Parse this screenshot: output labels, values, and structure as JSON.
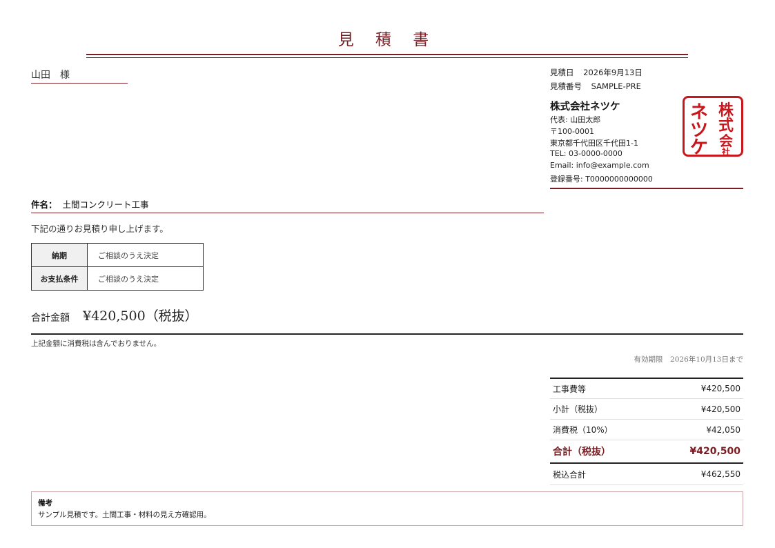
{
  "title": "見 積 書",
  "recipient": "山田　様",
  "meta": {
    "date_label": "見積日",
    "date_value": "2026年9月13日",
    "number_label": "見積番号",
    "number_value": "SAMPLE-PRE"
  },
  "company": {
    "name": "株式会社ネツケ",
    "representative": "代表: 山田太郎",
    "postal": "〒100-0001",
    "address": "東京都千代田区千代田1-1",
    "tel": "TEL: 03-0000-0000",
    "email": "Email: info@example.com",
    "registration": "登録番号: T0000000000000",
    "stamp_text": "株式会社ネツケ",
    "stamp_color": "#c8161d"
  },
  "subject": {
    "label": "件名：",
    "value": "土間コンクリート工事"
  },
  "lead_text": "下記の通りお見積り申し上げます。",
  "terms": [
    {
      "label": "納期",
      "value": "ご相談のうえ決定"
    },
    {
      "label": "お支払条件",
      "value": "ご相談のうえ決定"
    }
  ],
  "total": {
    "label": "合計金額",
    "value": "¥420,500（税抜）"
  },
  "tax_note": "上記金額に消費税は含んでおりません。",
  "validity": "有効期限　2026年10月13日まで",
  "summary": [
    {
      "label": "工事費等",
      "value": "¥420,500"
    },
    {
      "label": "小計（税抜）",
      "value": "¥420,500"
    },
    {
      "label": "消費税（10%）",
      "value": "¥42,050"
    },
    {
      "label": "合計（税抜）",
      "value": "¥420,500"
    },
    {
      "label": "税込合計",
      "value": "¥462,550"
    }
  ],
  "remarks": {
    "title": "備考",
    "body": "サンプル見積です。土間工事・材料の見え方確認用。"
  },
  "colors": {
    "accent": "#7a1c22",
    "stamp": "#c8161d"
  }
}
